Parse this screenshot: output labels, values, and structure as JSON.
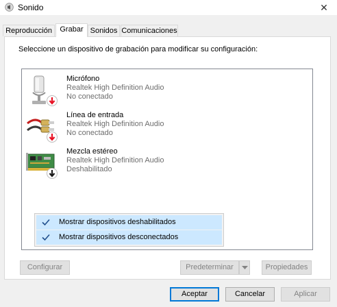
{
  "window": {
    "title": "Sonido",
    "close_symbol": "✕"
  },
  "tabs": [
    {
      "label": "Reproducción",
      "active": false
    },
    {
      "label": "Grabar",
      "active": true
    },
    {
      "label": "Sonidos",
      "active": false
    },
    {
      "label": "Comunicaciones",
      "active": false
    }
  ],
  "panel": {
    "instruction": "Seleccione un dispositivo de grabación para modificar su configuración:"
  },
  "devices": [
    {
      "name": "Micrófono",
      "driver": "Realtek High Definition Audio",
      "status": "No conectado",
      "icon": "microphone-icon",
      "badge": "red-down-arrow"
    },
    {
      "name": "Línea de entrada",
      "driver": "Realtek High Definition Audio",
      "status": "No conectado",
      "icon": "rca-cable-icon",
      "badge": "red-down-arrow"
    },
    {
      "name": "Mezcla estéreo",
      "driver": "Realtek High Definition Audio",
      "status": "Deshabilitado",
      "icon": "sound-card-icon",
      "badge": "black-down-arrow"
    }
  ],
  "context_menu": {
    "items": [
      {
        "label": "Mostrar dispositivos deshabilitados",
        "checked": true
      },
      {
        "label": "Mostrar dispositivos desconectados",
        "checked": true
      }
    ]
  },
  "buttons": {
    "configurar": "Configurar",
    "predeterminar": "Predeterminar",
    "propiedades": "Propiedades",
    "aceptar": "Aceptar",
    "cancelar": "Cancelar",
    "aplicar": "Aplicar"
  },
  "colors": {
    "accent": "#0078d7",
    "menu_highlight": "#cce8ff",
    "badge_red": "#e81123"
  }
}
